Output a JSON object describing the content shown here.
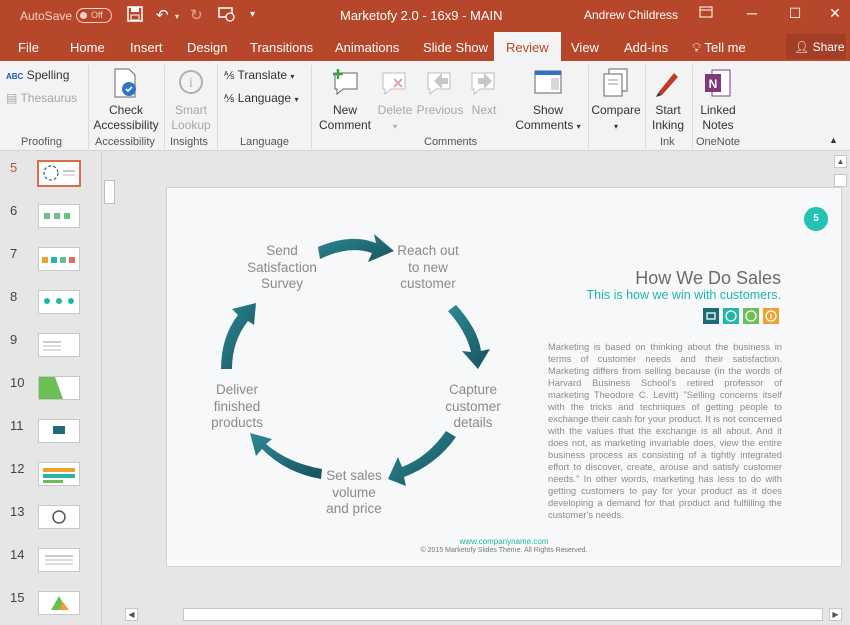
{
  "titlebar": {
    "autosave_label": "AutoSave",
    "autosave_state": "Off",
    "doc_title": "Marketofy 2.0 - 16x9 - MAIN",
    "user": "Andrew Childress"
  },
  "tabs": [
    "File",
    "Home",
    "Insert",
    "Design",
    "Transitions",
    "Animations",
    "Slide Show",
    "Review",
    "View",
    "Add-ins"
  ],
  "active_tab": "Review",
  "tellme": "Tell me",
  "share": "Share",
  "ribbon": {
    "proofing": {
      "label": "Proofing",
      "spelling": "Spelling",
      "thesaurus": "Thesaurus"
    },
    "accessibility": {
      "label": "Accessibility",
      "check": "Check",
      "check2": "Accessibility"
    },
    "insights": {
      "label": "Insights",
      "smart": "Smart",
      "smart2": "Lookup"
    },
    "language": {
      "label": "Language",
      "translate": "Translate",
      "language": "Language"
    },
    "comments": {
      "label": "Comments",
      "new1": "New",
      "new2": "Comment",
      "delete": "Delete",
      "previous": "Previous",
      "next": "Next",
      "show1": "Show",
      "show2": "Comments"
    },
    "compare": {
      "label": "Compare"
    },
    "ink": {
      "label": "Ink",
      "start1": "Start",
      "start2": "Inking"
    },
    "onenote": {
      "label": "OneNote",
      "linked1": "Linked",
      "linked2": "Notes"
    }
  },
  "thumbnails": [
    {
      "num": "5"
    },
    {
      "num": "6"
    },
    {
      "num": "7"
    },
    {
      "num": "8"
    },
    {
      "num": "9"
    },
    {
      "num": "10"
    },
    {
      "num": "11"
    },
    {
      "num": "12"
    },
    {
      "num": "13"
    },
    {
      "num": "14"
    },
    {
      "num": "15"
    }
  ],
  "slide": {
    "number": "5",
    "steps": {
      "s1a": "Send",
      "s1b": "Satisfaction",
      "s1c": "Survey",
      "s2a": "Reach out",
      "s2b": "to new",
      "s2c": "customer",
      "s3a": "Capture",
      "s3b": "customer",
      "s3c": "details",
      "s4a": "Set sales",
      "s4b": "volume",
      "s4c": "and price",
      "s5a": "Deliver",
      "s5b": "finished",
      "s5c": "products"
    },
    "title": "How We Do Sales",
    "subtitle": "This is how we win with customers.",
    "body": "Marketing is based on thinking about the business in terms of customer needs and their satisfaction. Marketing differs from selling because (in the words of Harvard Business School's retired professor of marketing Theodore C. Levitt) \"Selling concerns itself with the tricks and techniques of getting people to exchange their cash for your product. It is not concerned with the values that the exchange is all about. And it does not, as marketing invariable does, view the entire business process as consisting of a tightly integrated effort to discover, create, arouse and satisfy customer needs.\" In other words, marketing has less to do with getting customers to pay for your product as it does developing a demand for that product and fulfilling the customer's needs.",
    "url": "www.companyname.com",
    "copyright": "© 2015 Marketofy Slides Theme. All Rights Reserved."
  },
  "colors": {
    "brand": "#b7472a",
    "teal": "#21b6a8",
    "arrow": "#1d6b78"
  }
}
